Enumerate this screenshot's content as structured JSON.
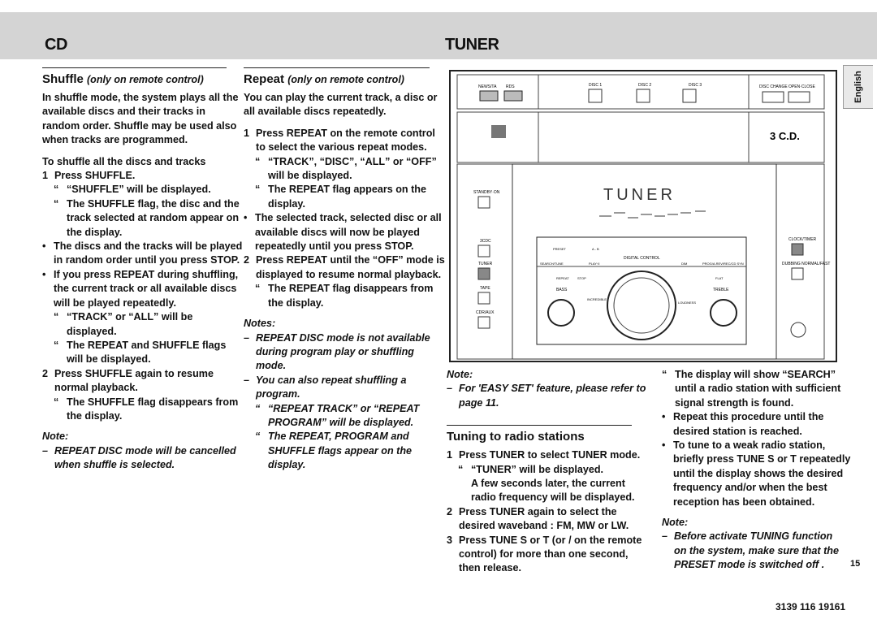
{
  "header": {
    "left": "CD",
    "right": "TUNER"
  },
  "language_tab": "English",
  "shuffle": {
    "title": "Shuffle",
    "subtitle": "(only on remote control)",
    "intro": "In shuffle mode, the system plays all the available discs and their tracks in random order. Shuffle may be used also when tracks are programmed.",
    "subhead": "To shuffle all the discs and tracks",
    "step1": "Press SHUFFLE.",
    "step1_r1": "“SHUFFLE” will be displayed.",
    "step1_r2": "The SHUFFLE flag, the disc and the track selected at random appear on the display.",
    "b1": "The discs and the tracks will be played in random order until you press STOP.",
    "b2": "If you press REPEAT during shuffling, the current track or all available discs will be played repeatedly.",
    "b2_r1": "“TRACK” or “ALL” will be displayed.",
    "b2_r2": "The REPEAT and SHUFFLE flags will be displayed.",
    "step2": "Press SHUFFLE again to resume normal playback.",
    "step2_r1": "The SHUFFLE flag disappears from the display.",
    "note_label": "Note:",
    "note": "REPEAT DISC mode will be cancelled when shuffle is selected."
  },
  "repeat": {
    "title": "Repeat",
    "subtitle": "(only on remote control)",
    "intro": "You can play the current track, a disc or all available discs repeatedly.",
    "step1": "Press REPEAT on the remote control to select the various repeat modes.",
    "step1_r1": "“TRACK”, “DISC”, “ALL” or “OFF” will be displayed.",
    "step1_r2": "The REPEAT flag appears on the display.",
    "b1": "The selected track, selected disc or all available discs will now be played repeatedly until you press STOP.",
    "step2": "Press REPEAT until the “OFF” mode is displayed to resume normal playback.",
    "step2_r1": "The REPEAT flag disappears from the display.",
    "notes_label": "Notes:",
    "n1": "REPEAT DISC mode is not available during program play or shuffling mode.",
    "n2": "You can also repeat shuffling a program.",
    "n2_r1": "“REPEAT TRACK” or “REPEAT PROGRAM” will be displayed.",
    "n2_r2": "The REPEAT, PROGRAM and SHUFFLE flags appear on the display."
  },
  "tuner": {
    "note_label": "Note:",
    "note": "For 'EASY SET' feature, please refer to page 11.",
    "title": "Tuning to radio stations",
    "step1": "Press TUNER to select TUNER mode.",
    "step1_r1": "“TUNER” will be displayed.",
    "step1_r1b": "A few seconds later, the current radio frequency will be displayed.",
    "step2": "Press TUNER again to select the desired waveband : FM, MW or LW.",
    "step3": "Press TUNE S or T (or / on the remote control) for more than one second, then release.",
    "step3_r1": "The display will show “SEARCH” until a radio station with sufficient signal strength is found.",
    "b1": "Repeat this procedure until the desired station is reached.",
    "b2": "To tune to a weak radio station, briefly press TUNE S or T repeatedly until the display shows the desired frequency and/or when the best reception has been obtained.",
    "note2_label": "Note:",
    "note2": "Before activate TUNING function on the system, make sure that the PRESET mode is switched off ."
  },
  "device": {
    "buttons_top": [
      "NEWS/TA",
      "RDS",
      "DISC 1",
      "DISC 2",
      "DISC 3",
      "DISC CHANGE",
      "OPEN·CLOSE"
    ],
    "display_text": "TUNER",
    "brand_mark": "3 C.D.",
    "left_buttons": [
      "STANDBY·ON",
      "3CDC",
      "TUNER",
      "TAPE",
      "CDR/AUX"
    ],
    "right_buttons": [
      "CLOCK/TIMER",
      "DUBBING NORMAL/FAST"
    ],
    "panel_labels": [
      "PRESET",
      "A - B",
      "DIGITAL CONTROL",
      "SEARCH/TUNE",
      "PLAY·II",
      "DIM",
      "PROG/A.REV/REC/CD SYN",
      "REPEAT",
      "STOP",
      "FLAT",
      "BASS",
      "TREBLE",
      "INCREDIBLE SURROUND",
      "LOUDNESS"
    ]
  },
  "footer": {
    "page_number": "15",
    "code": "3139 116 19161"
  }
}
